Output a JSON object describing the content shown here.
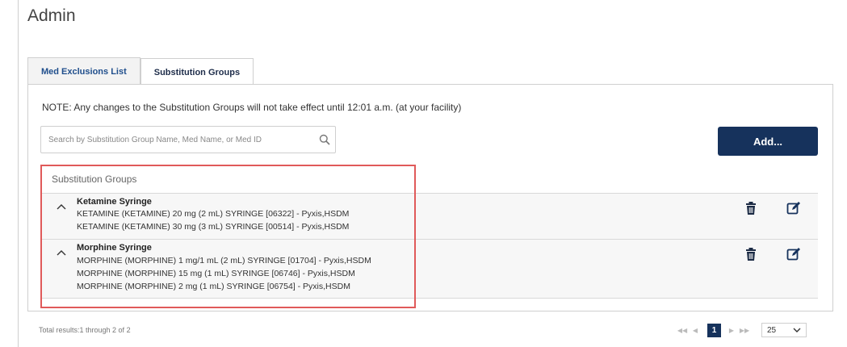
{
  "page": {
    "title": "Admin"
  },
  "tabs": [
    {
      "label": "Med Exclusions List",
      "active": false
    },
    {
      "label": "Substitution Groups",
      "active": true
    }
  ],
  "note": "NOTE: Any changes to the Substitution Groups will not take effect until 12:01 a.m. (at your facility)",
  "search": {
    "placeholder": "Search by Substitution Group Name, Med Name, or Med ID",
    "value": ""
  },
  "add_button_label": "Add...",
  "grid": {
    "header": "Substitution Groups",
    "groups": [
      {
        "name": "Ketamine Syringe",
        "meds": [
          "KETAMINE (KETAMINE) 20 mg (2 mL) SYRINGE [06322] - Pyxis,HSDM",
          "KETAMINE (KETAMINE) 30 mg (3 mL) SYRINGE [00514] - Pyxis,HSDM"
        ]
      },
      {
        "name": "Morphine Syringe",
        "meds": [
          "MORPHINE (MORPHINE) 1 mg/1 mL (2 mL) SYRINGE [01704] - Pyxis,HSDM",
          "MORPHINE (MORPHINE) 15 mg (1 mL) SYRINGE [06746] - Pyxis,HSDM",
          "MORPHINE (MORPHINE) 2 mg (1 mL) SYRINGE [06754] - Pyxis,HSDM"
        ]
      }
    ]
  },
  "footer": {
    "total_results": "Total results:1 through 2 of 2",
    "current_page": "1",
    "page_size": "25"
  },
  "colors": {
    "primary": "#16325c",
    "highlight": "#e05a5a",
    "tab_link": "#1f4e8c"
  },
  "icons": [
    "search-icon",
    "trash-icon",
    "edit-icon",
    "chevron-up-icon",
    "chevron-down-icon",
    "first-page-icon",
    "prev-page-icon",
    "next-page-icon",
    "last-page-icon"
  ]
}
